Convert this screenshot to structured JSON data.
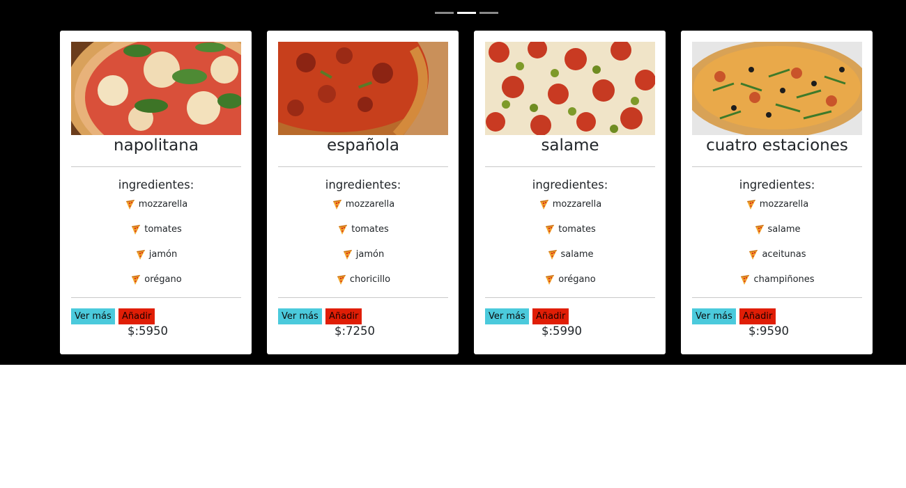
{
  "carousel": {
    "indicators": [
      {
        "active": false
      },
      {
        "active": true
      },
      {
        "active": false
      }
    ]
  },
  "products": [
    {
      "name": "napolitana",
      "ingredients_title": "ingredientes:",
      "ingredients": [
        "mozzarella",
        "tomates",
        "jamón",
        "orégano"
      ],
      "more_label": "Ver más",
      "add_label": "Añadir",
      "price": "$:5950",
      "image": "pizza-napolitana-photo"
    },
    {
      "name": "española",
      "ingredients_title": "ingredientes:",
      "ingredients": [
        "mozzarella",
        "tomates",
        "jamón",
        "choricillo"
      ],
      "more_label": "Ver más",
      "add_label": "Añadir",
      "price": "$:7250",
      "image": "pizza-espanola-photo"
    },
    {
      "name": "salame",
      "ingredients_title": "ingredientes:",
      "ingredients": [
        "mozzarella",
        "tomates",
        "salame",
        "orégano"
      ],
      "more_label": "Ver más",
      "add_label": "Añadir",
      "price": "$:5990",
      "image": "pizza-salame-photo"
    },
    {
      "name": "cuatro estaciones",
      "ingredients_title": "ingredientes:",
      "ingredients": [
        "mozzarella",
        "salame",
        "aceitunas",
        "champiñones"
      ],
      "more_label": "Ver más",
      "add_label": "Añadir",
      "price": "$:9590",
      "image": "pizza-cuatro-estaciones-photo"
    }
  ],
  "colors": {
    "background": "#000000",
    "more_button": "#4bcadc",
    "add_button": "#e01e06"
  },
  "icons": {
    "ingredient": "pizza-slice-icon"
  }
}
